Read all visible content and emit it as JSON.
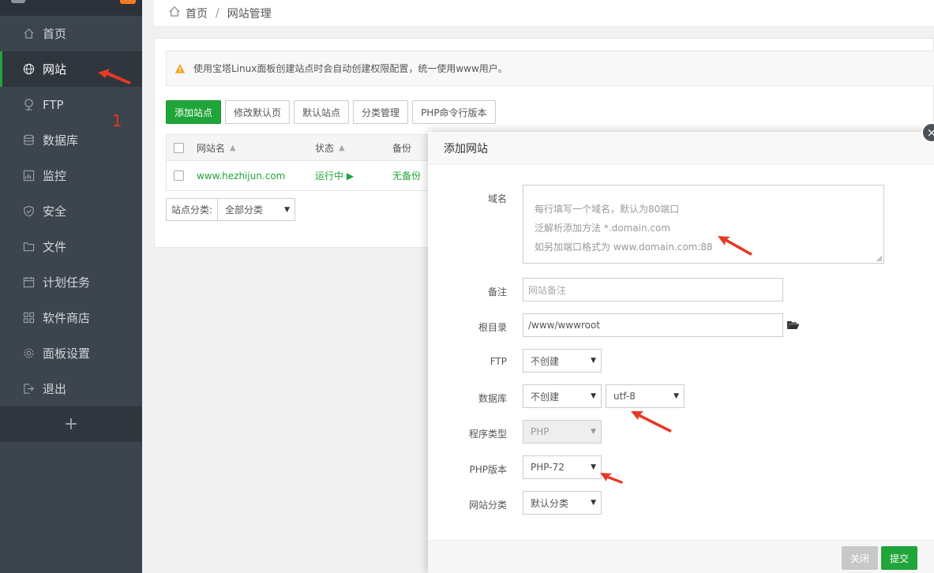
{
  "sidebar": {
    "items": [
      {
        "label": "首页",
        "icon": "home-icon"
      },
      {
        "label": "网站",
        "icon": "globe-icon",
        "active": true
      },
      {
        "label": "FTP",
        "icon": "ftp-icon"
      },
      {
        "label": "数据库",
        "icon": "database-icon"
      },
      {
        "label": "监控",
        "icon": "monitor-icon"
      },
      {
        "label": "安全",
        "icon": "shield-icon"
      },
      {
        "label": "文件",
        "icon": "folder-icon"
      },
      {
        "label": "计划任务",
        "icon": "calendar-icon"
      },
      {
        "label": "软件商店",
        "icon": "grid-icon"
      },
      {
        "label": "面板设置",
        "icon": "gear-icon"
      },
      {
        "label": "退出",
        "icon": "logout-icon"
      }
    ],
    "add_label": "+"
  },
  "breadcrumb": {
    "home": "首页",
    "separator": "/",
    "current": "网站管理"
  },
  "alert": {
    "text": "使用宝塔Linux面板创建站点时会自动创建权限配置，统一使用www用户。"
  },
  "toolbar": {
    "buttons": [
      "添加站点",
      "修改默认页",
      "默认站点",
      "分类管理",
      "PHP命令行版本"
    ]
  },
  "table": {
    "headers": {
      "name": "网站名",
      "status": "状态",
      "backup": "备份"
    },
    "rows": [
      {
        "name": "www.hezhijun.com",
        "status": "运行中 ▶",
        "backup": "无备份"
      }
    ]
  },
  "category_filter": {
    "label": "站点分类:",
    "value": "全部分类"
  },
  "annotation": {
    "number": "1"
  },
  "modal": {
    "title": "添加网站",
    "close": "×",
    "domain": {
      "label": "域名",
      "placeholder_lines": [
        "每行填写一个域名，默认为80端口",
        "泛解析添加方法 *.domain.com",
        "如另加端口格式为 www.domain.com:88"
      ]
    },
    "note": {
      "label": "备注",
      "placeholder": "网站备注"
    },
    "root": {
      "label": "根目录",
      "value": "/www/wwwroot"
    },
    "ftp": {
      "label": "FTP",
      "value": "不创建"
    },
    "database": {
      "label": "数据库",
      "value": "不创建",
      "charset": "utf-8"
    },
    "program_type": {
      "label": "程序类型",
      "value": "PHP"
    },
    "php_version": {
      "label": "PHP版本",
      "value": "PHP-72"
    },
    "site_category": {
      "label": "网站分类",
      "value": "默认分类"
    },
    "buttons": {
      "close": "关闭",
      "submit": "提交"
    }
  },
  "colors": {
    "accent": "#20a53a",
    "sidebar": "#3c444d",
    "annotation": "#e53925"
  }
}
